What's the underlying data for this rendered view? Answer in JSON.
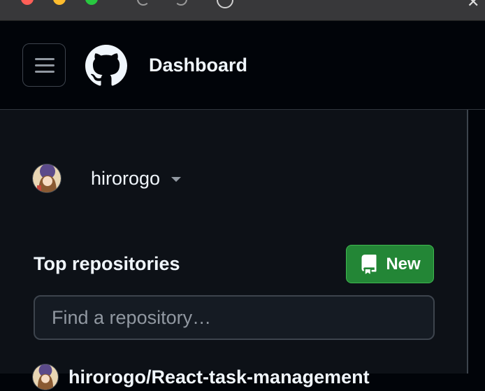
{
  "header": {
    "title": "Dashboard"
  },
  "account": {
    "username": "hirorogo"
  },
  "repositories": {
    "heading": "Top repositories",
    "new_button_label": "New",
    "search_placeholder": "Find a repository…",
    "items": [
      {
        "name": "hirorogo/React-task-management"
      }
    ]
  },
  "colors": {
    "background": "#010409",
    "panel": "#0d1117",
    "primary_button": "#238636",
    "border": "#3d444d"
  },
  "icons": {
    "menu": "hamburger-icon",
    "logo": "github-octocat-icon",
    "new_repo": "repo-icon",
    "account_switch": "caret-down-icon"
  }
}
